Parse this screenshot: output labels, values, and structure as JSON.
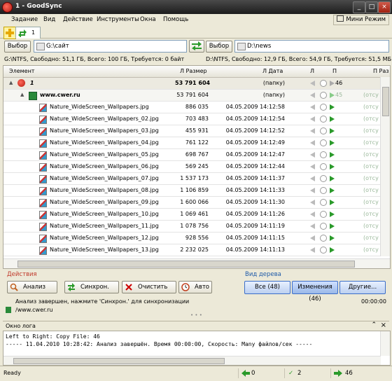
{
  "window": {
    "title": "1 - GoodSync"
  },
  "menu": [
    "Задание",
    "Вид",
    "Действие",
    "Инструменты",
    "Окна",
    "Помощь"
  ],
  "mini_mode": "Мини Режим",
  "tabs": {
    "active_label": "1"
  },
  "paths": {
    "browse_left": "Выбор",
    "left_path": "G:\\сайт",
    "browse_right": "Выбор",
    "right_path": "D:\\news"
  },
  "info": {
    "left": "G:\\NTFS, Свободно: 51,1 ГБ, Всего: 100 ГБ, Требуется: 0 байт",
    "right": "D:\\NTFS, Свободно: 12,9 ГБ, Всего: 54,9 ГБ, Требуется: 51,5 МБ"
  },
  "grid": {
    "headers": {
      "element": "Элемент",
      "lsize": "Л Размер",
      "ldate": "Л Дата",
      "l": "Л",
      "p": "П",
      "psize": "П Раз"
    },
    "root": {
      "name": "1",
      "size": "53 791 604",
      "date": "(папку)",
      "count": "46"
    },
    "folder": {
      "name": "www.cwer.ru",
      "size": "53 791 604",
      "date": "(папку)",
      "right": "(отсу",
      "count": "45"
    },
    "rows": [
      {
        "name": "Nature_WideScreen_Wallpapers.jpg",
        "size": "886 035",
        "date": "04.05.2009 14:12:58",
        "right": "(отсу"
      },
      {
        "name": "Nature_WideScreen_Wallpapers_02.jpg",
        "size": "703 483",
        "date": "04.05.2009 14:12:54",
        "right": "(отсу"
      },
      {
        "name": "Nature_WideScreen_Wallpapers_03.jpg",
        "size": "455 931",
        "date": "04.05.2009 14:12:52",
        "right": "(отсу"
      },
      {
        "name": "Nature_WideScreen_Wallpapers_04.jpg",
        "size": "761 122",
        "date": "04.05.2009 14:12:49",
        "right": "(отсу"
      },
      {
        "name": "Nature_WideScreen_Wallpapers_05.jpg",
        "size": "698 767",
        "date": "04.05.2009 14:12:47",
        "right": "(отсу"
      },
      {
        "name": "Nature_WideScreen_Wallpapers_06.jpg",
        "size": "569 245",
        "date": "04.05.2009 14:12:44",
        "right": "(отсу"
      },
      {
        "name": "Nature_WideScreen_Wallpapers_07.jpg",
        "size": "1 537 173",
        "date": "04.05.2009 14:11:37",
        "right": "(отсу"
      },
      {
        "name": "Nature_WideScreen_Wallpapers_08.jpg",
        "size": "1 106 859",
        "date": "04.05.2009 14:11:33",
        "right": "(отсу"
      },
      {
        "name": "Nature_WideScreen_Wallpapers_09.jpg",
        "size": "1 600 066",
        "date": "04.05.2009 14:11:30",
        "right": "(отсу"
      },
      {
        "name": "Nature_WideScreen_Wallpapers_10.jpg",
        "size": "1 069 461",
        "date": "04.05.2009 14:11:26",
        "right": "(отсу"
      },
      {
        "name": "Nature_WideScreen_Wallpapers_11.jpg",
        "size": "1 078 756",
        "date": "04.05.2009 14:11:19",
        "right": "(отсу"
      },
      {
        "name": "Nature_WideScreen_Wallpapers_12.jpg",
        "size": "928 556",
        "date": "04.05.2009 14:11:15",
        "right": "(отсу"
      },
      {
        "name": "Nature_WideScreen_Wallpapers_13.jpg",
        "size": "2 232 025",
        "date": "04.05.2009 14:11:13",
        "right": "(отсу"
      }
    ]
  },
  "actions": {
    "group_label": "Действия",
    "analyze": "Анализ",
    "sync": "Синхрон.",
    "clear": "Очистить",
    "auto": "Авто"
  },
  "tree_view": {
    "group_label": "Вид дерева",
    "all": "Все (48)",
    "changes": "Изменения (46)",
    "other": "Другие..."
  },
  "status": {
    "message": "Анализ завершен, нажмите 'Синхрон.' для синхронизации",
    "time": "00:00:00",
    "path": "/www.cwer.ru"
  },
  "log": {
    "title": "Окно лога",
    "lines": [
      "Left to Right: Copy File: 46",
      "----- 11.04.2010 10:28:42: Анализ завершён. Время 00:00:00, Скорость: Many файлов/сек -----"
    ]
  },
  "statusbar": {
    "ready": "Ready",
    "left_count": "0",
    "check_count": "2",
    "right_count": "46"
  },
  "colors": {
    "green_arrow": "#2a9a2a",
    "view_btn_border": "#3c6ec8",
    "red_label": "#c0392b",
    "blue_label": "#1e5aa8"
  }
}
